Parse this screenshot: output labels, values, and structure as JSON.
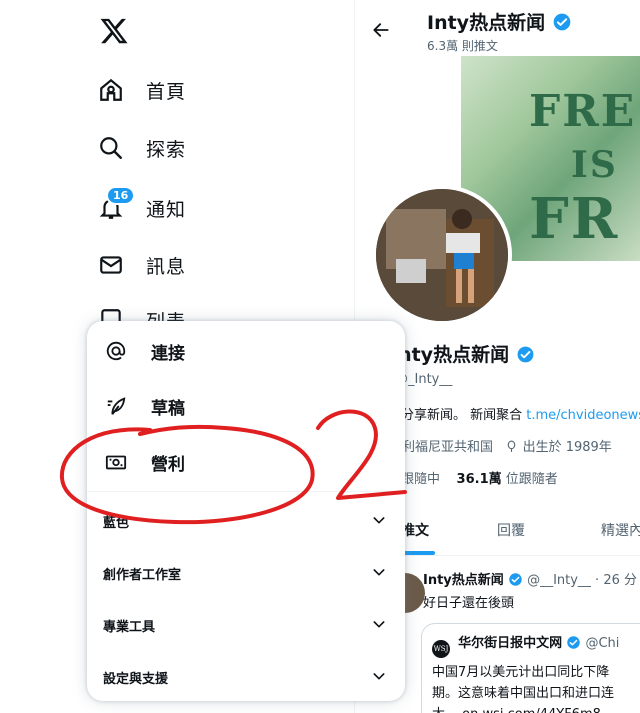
{
  "nav": {
    "items": [
      {
        "label": "首頁"
      },
      {
        "label": "探索"
      },
      {
        "label": "通知",
        "badge": "16"
      },
      {
        "label": "訊息"
      },
      {
        "label": "列表"
      }
    ]
  },
  "profile": {
    "header_name": "Inty热点新闻",
    "header_count": "6.3萬 則推文",
    "banner_lines": [
      "FRE",
      "IS",
      "FR"
    ],
    "name": "Inty热点新闻",
    "handle": "@_Inty__",
    "bio": "分享新闻。 新闻聚合 ",
    "bio_link": "t.me/chvideonews",
    "location": "利福尼亚共和国",
    "birth": "出生於 1989年",
    "following_label": "跟隨中",
    "followers_count": "36.1萬",
    "followers_label": "位跟隨者",
    "tabs": [
      "推文",
      "回覆",
      "精選內容"
    ]
  },
  "tweet": {
    "name": "Inty热点新闻",
    "meta": "@__Inty__ · 26 分",
    "text": "好日子還在後頭",
    "quote_logo": "WSJ",
    "quote_name": "华尔街日报中文网",
    "quote_handle": "@Chi",
    "quote_line1": "中国7月以美元计出口同比下降",
    "quote_line2": "期。这意味着中国出口和进口连",
    "quote_line3": "大。 on.wsj.com/44YF6m8"
  },
  "menu": {
    "items": [
      {
        "label": "連接"
      },
      {
        "label": "草稿"
      },
      {
        "label": "營利"
      }
    ],
    "sections": [
      {
        "label": "藍色"
      },
      {
        "label": "創作者工作室"
      },
      {
        "label": "專業工具"
      },
      {
        "label": "設定與支援"
      }
    ]
  },
  "annotation": {
    "number": "2",
    "color": "#e02020"
  }
}
